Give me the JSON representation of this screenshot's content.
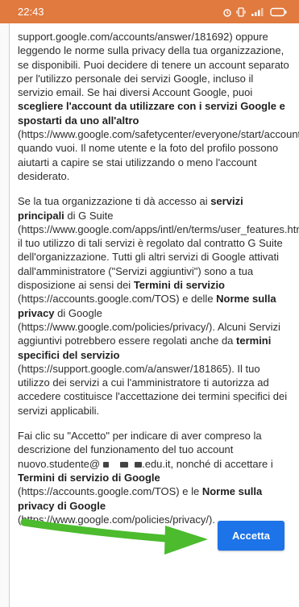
{
  "status_bar": {
    "time": "22:43",
    "icons": [
      "alarm-icon",
      "vibrate-icon",
      "signal-icon",
      "battery-icon"
    ],
    "bg_color": "#e07a3f"
  },
  "terms": {
    "p1": {
      "t1": "support.google.com/accounts/answer/181692) oppure leggendo le norme sulla privacy della tua organizzazione, se disponibili. Puoi decidere di tenere un account separato per l'utilizzo personale dei servizi Google, incluso il servizio email. Se hai diversi Account Google, puoi ",
      "b1": "scegliere l'account da utilizzare con i servizi Google e spostarti da uno all'altro",
      "t2": " (https://www.google.com/safetycenter/everyone/start/accounts/) quando vuoi. Il nome utente e la foto del profilo possono aiutarti a capire se stai utilizzando o meno l'account desiderato."
    },
    "p2": {
      "t1": "Se la tua organizzazione ti dà accesso ai ",
      "b1": "servizi principali",
      "t2": " di G Suite (https://www.google.com/apps/intl/en/terms/user_features.html), il tuo utilizzo di tali servizi è regolato dal contratto G Suite dell'organizzazione. Tutti gli altri servizi di Google attivati dall'amministratore (\"Servizi aggiuntivi\") sono a tua disposizione ai sensi dei ",
      "b2": "Termini di servizio",
      "t3": " (https://accounts.google.com/TOS) e delle ",
      "b3": "Norme sulla privacy",
      "t4": " di Google (https://www.google.com/policies/privacy/). Alcuni Servizi aggiuntivi potrebbero essere regolati anche da ",
      "b4": "termini specifici del servizio",
      "t5": " (https://support.google.com/a/answer/181865). Il tuo utilizzo dei servizi a cui l'amministratore ti autorizza ad accedere costituisce l'accettazione dei termini specifici dei servizi applicabili."
    },
    "p3": {
      "t1": "Fai clic su \"Accetto\" per indicare di aver compreso la descrizione del funzionamento del tuo account nuovo.studente@",
      "t2": ".edu.it, nonché di accettare i ",
      "b1": "Termini di servizio di Google",
      "t3": " (https://accounts.google.com/TOS) e le ",
      "b2": "Norme sulla privacy di Google",
      "t4": " (https://www.google.com/policies/privacy/)."
    }
  },
  "accept_button": {
    "label": "Accetta",
    "color": "#1d73e8"
  },
  "annotation": {
    "arrow_color": "#4cbb2e"
  }
}
